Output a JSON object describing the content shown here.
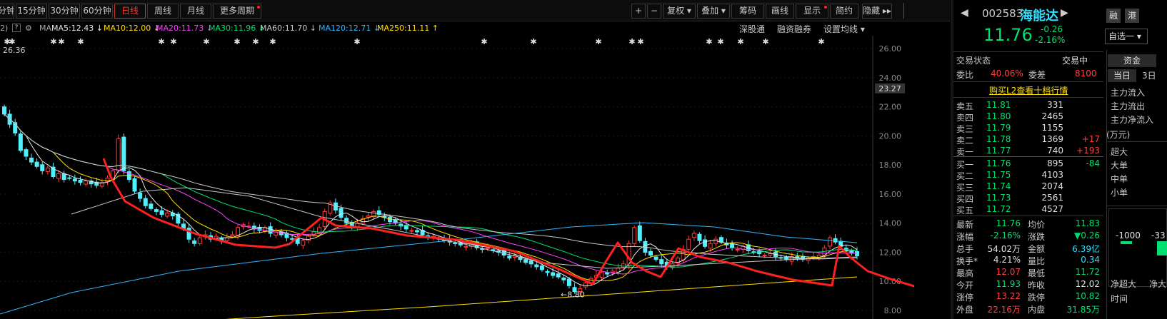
{
  "toolbar": {
    "periods": [
      "分钟",
      "15分钟",
      "30分钟",
      "60分钟",
      "日线",
      "周线",
      "月线",
      "更多周期"
    ],
    "right": [
      "+",
      "−",
      "复权",
      "叠加",
      "筹码",
      "画线",
      "显示",
      "简约",
      "隐藏"
    ]
  },
  "ma_bar": {
    "prefix": "MA",
    "items": [
      {
        "label": "MA5:12.43",
        "arrow": "↓",
        "color": "#e8e8e8"
      },
      {
        "label": "MA10:12.00",
        "arrow": "↓",
        "color": "#ffe000"
      },
      {
        "label": "MA20:11.73",
        "arrow": "↓",
        "color": "#ff40ff"
      },
      {
        "label": "MA30:11.96",
        "arrow": "↓",
        "color": "#00e070"
      },
      {
        "label": "MA60:11.70",
        "arrow": "↓",
        "color": "#c8c8c8"
      },
      {
        "label": "MA120:12.71",
        "arrow": "↓",
        "color": "#30b8ff"
      },
      {
        "label": "MA250:11.11",
        "arrow": "↑",
        "color": "#ffe000"
      }
    ],
    "links": [
      "深股通",
      "融资融券",
      "设置均线"
    ]
  },
  "chart_data": {
    "type": "candlestick",
    "yticks": [
      "26.00",
      "24.00",
      "22.00",
      "20.00",
      "18.00",
      "16.00",
      "14.00",
      "12.00",
      "10.00",
      "8.00"
    ],
    "price_label": "23.27",
    "top_label": "26.36",
    "low_label": "8.80",
    "ylim": [
      8,
      26.5
    ],
    "closes": [
      21.5,
      20.8,
      20.2,
      19.0,
      18.6,
      18.2,
      17.9,
      17.6,
      17.8,
      17.2,
      17.4,
      17.0,
      17.1,
      16.9,
      16.8,
      16.9,
      16.7,
      16.6,
      16.8,
      17.1,
      17.6,
      19.8,
      17.6,
      17.0,
      16.2,
      15.7,
      15.2,
      15.0,
      14.8,
      14.6,
      14.7,
      14.5,
      14.0,
      13.6,
      12.9,
      12.6,
      13.0,
      13.2,
      12.9,
      13.1,
      12.8,
      13.0,
      13.2,
      13.7,
      13.9,
      13.8,
      13.6,
      13.5,
      13.7,
      13.3,
      13.4,
      13.2,
      13.0,
      12.9,
      12.6,
      12.8,
      13.1,
      13.4,
      13.7,
      14.8,
      15.4,
      14.9,
      14.4,
      14.0,
      13.8,
      14.0,
      14.3,
      14.5,
      14.8,
      14.6,
      14.4,
      14.1,
      14.0,
      13.8,
      13.6,
      13.5,
      13.4,
      13.2,
      13.0,
      13.1,
      12.9,
      12.8,
      12.7,
      12.6,
      12.5,
      12.4,
      12.6,
      12.3,
      12.2,
      12.3,
      12.1,
      12.0,
      11.8,
      11.6,
      11.8,
      11.5,
      11.3,
      11.2,
      11.0,
      10.8,
      10.6,
      10.4,
      10.3,
      10.1,
      9.7,
      9.3,
      9.5,
      9.9,
      10.2,
      10.4,
      10.6,
      10.5,
      10.7,
      10.9,
      11.2,
      12.6,
      13.7,
      12.8,
      12.0,
      11.8,
      11.5,
      11.2,
      11.0,
      11.2,
      11.6,
      12.2,
      12.9,
      13.3,
      12.8,
      12.4,
      12.6,
      12.9,
      12.7,
      12.5,
      12.3,
      12.2,
      12.4,
      12.1,
      12.0,
      11.9,
      11.8,
      11.9,
      11.7,
      11.6,
      11.5,
      11.7,
      11.6,
      11.5,
      11.6,
      11.7,
      11.8,
      12.3,
      13.0,
      12.7,
      12.4,
      12.1,
      11.93,
      11.76
    ],
    "red_line": [
      [
        145,
        172
      ],
      [
        155,
        198
      ],
      [
        175,
        232
      ],
      [
        215,
        255
      ],
      [
        275,
        278
      ],
      [
        330,
        293
      ],
      [
        385,
        297
      ],
      [
        405,
        292
      ],
      [
        450,
        255
      ],
      [
        470,
        266
      ],
      [
        520,
        270
      ],
      [
        570,
        280
      ],
      [
        640,
        286
      ],
      [
        720,
        302
      ],
      [
        780,
        326
      ],
      [
        830,
        348
      ],
      [
        848,
        317
      ],
      [
        865,
        290
      ],
      [
        885,
        318
      ],
      [
        905,
        330
      ],
      [
        925,
        338
      ],
      [
        950,
        298
      ],
      [
        980,
        310
      ],
      [
        1020,
        318
      ],
      [
        1060,
        330
      ],
      [
        1110,
        342
      ],
      [
        1165,
        350
      ],
      [
        1175,
        295
      ],
      [
        1190,
        310
      ],
      [
        1215,
        330
      ],
      [
        1250,
        342
      ],
      [
        1290,
        354
      ],
      [
        1330,
        370
      ]
    ],
    "red_color": "#ff2020"
  },
  "stock": {
    "code": "002583",
    "name": "海能达",
    "price": "11.76",
    "change": "-0.26",
    "pct": "-2.16%",
    "tag1": "融",
    "tag2": "港",
    "select": "自选一"
  },
  "book": {
    "status_label": "交易状态",
    "status": "交易中",
    "ratio_label": "委比",
    "ratio": "40.06%",
    "diff_label": "委差",
    "diff": "8100",
    "l2": "购买L2查看十档行情",
    "asks": [
      [
        "卖五",
        "11.81",
        "331",
        ""
      ],
      [
        "卖四",
        "11.80",
        "2465",
        ""
      ],
      [
        "卖三",
        "11.79",
        "1155",
        ""
      ],
      [
        "卖二",
        "11.78",
        "1369",
        "+17"
      ],
      [
        "卖一",
        "11.77",
        "740",
        "+193"
      ]
    ],
    "bids": [
      [
        "买一",
        "11.76",
        "895",
        "-84"
      ],
      [
        "买二",
        "11.75",
        "4103",
        ""
      ],
      [
        "买三",
        "11.74",
        "2074",
        ""
      ],
      [
        "买四",
        "11.73",
        "2561",
        ""
      ],
      [
        "买五",
        "11.72",
        "4527",
        ""
      ]
    ]
  },
  "stats": [
    [
      "最新",
      "11.76",
      "均价",
      "11.83"
    ],
    [
      "涨幅",
      "-2.16%",
      "涨跌",
      "▼0.26"
    ],
    [
      "总手",
      "54.02万",
      "金额",
      "6.39亿"
    ],
    [
      "换手*",
      "4.21%",
      "量比",
      "0.34"
    ],
    [
      "最高",
      "12.07",
      "最低",
      "11.72"
    ],
    [
      "今开",
      "11.93",
      "昨收",
      "12.02"
    ],
    [
      "涨停",
      "13.22",
      "跌停",
      "10.82"
    ],
    [
      "外盘",
      "22.16万",
      "内盘",
      "31.85万"
    ]
  ],
  "fund": {
    "tab": "资金",
    "day": "当日",
    "day3": "3日",
    "rows": [
      "主力流入",
      "主力流出",
      "主力净流入",
      "(万元)",
      "超大",
      "大单",
      "中单",
      "小单"
    ],
    "bar_vals": [
      "-1000",
      "-33"
    ],
    "axis": [
      "净超大",
      "净大"
    ],
    "time": "时间"
  }
}
